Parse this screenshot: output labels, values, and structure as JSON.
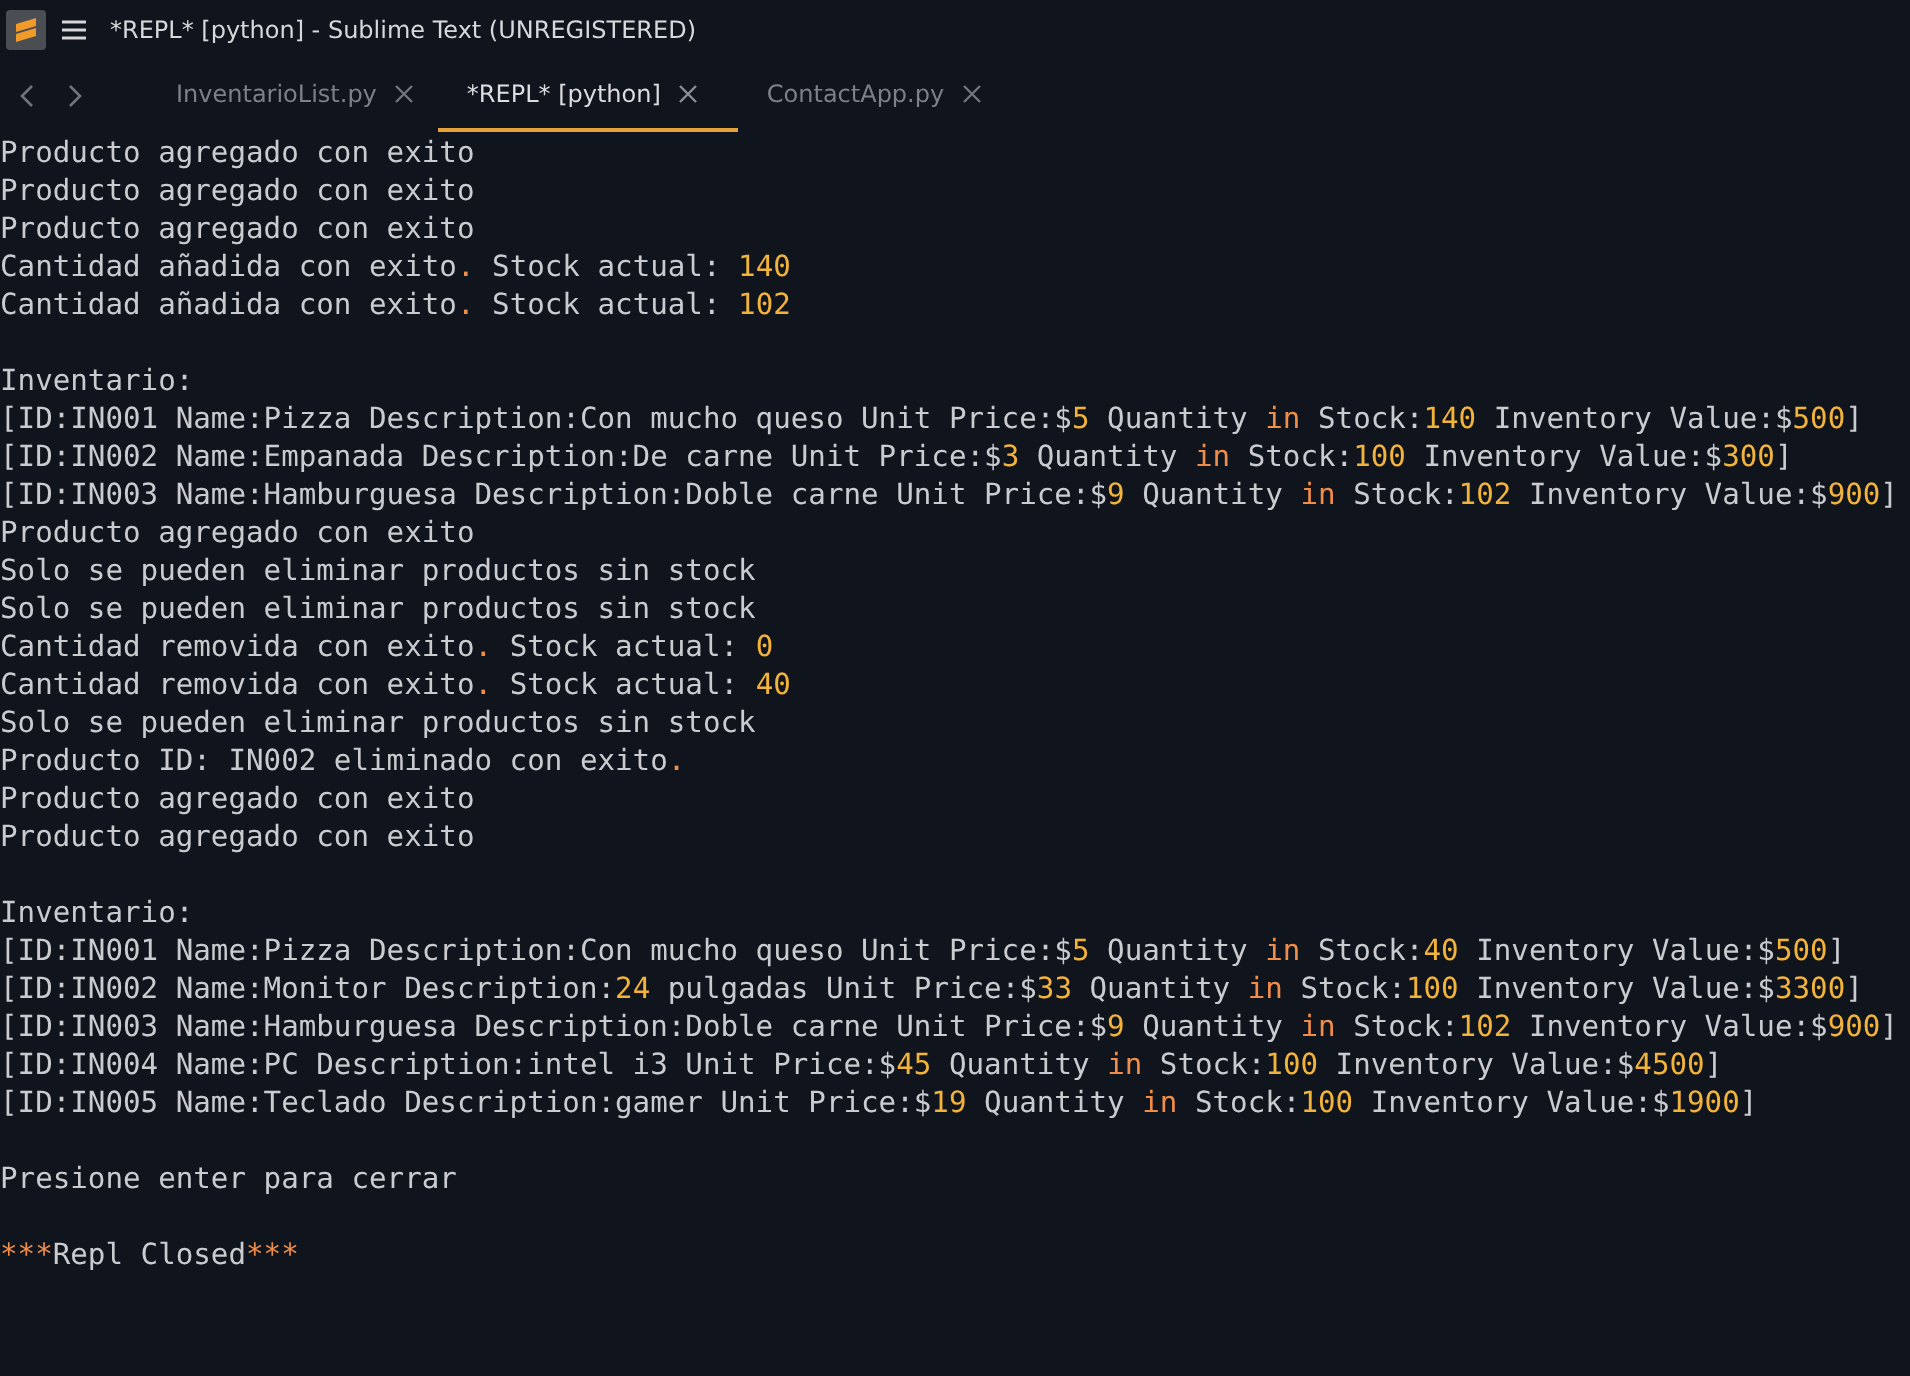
{
  "window": {
    "title": "*REPL* [python] - Sublime Text (UNREGISTERED)"
  },
  "tabs": [
    {
      "label": "InventarioList.py",
      "selected": false
    },
    {
      "label": "*REPL* [python]",
      "selected": true
    },
    {
      "label": "ContactApp.py",
      "selected": false
    }
  ],
  "console": {
    "lines": [
      {
        "kind": "text",
        "segments": [
          {
            "kind": "plain",
            "text": "Producto agregado con exito"
          }
        ]
      },
      {
        "kind": "text",
        "segments": [
          {
            "kind": "plain",
            "text": "Producto agregado con exito"
          }
        ]
      },
      {
        "kind": "text",
        "segments": [
          {
            "kind": "plain",
            "text": "Producto agregado con exito"
          }
        ]
      },
      {
        "kind": "text",
        "segments": [
          {
            "kind": "plain",
            "text": "Cantidad añadida con exito"
          },
          {
            "kind": "operator",
            "text": "."
          },
          {
            "kind": "plain",
            "text": " Stock actual: "
          },
          {
            "kind": "number",
            "text": "140"
          }
        ]
      },
      {
        "kind": "text",
        "segments": [
          {
            "kind": "plain",
            "text": "Cantidad añadida con exito"
          },
          {
            "kind": "operator",
            "text": "."
          },
          {
            "kind": "plain",
            "text": " Stock actual: "
          },
          {
            "kind": "number",
            "text": "102"
          }
        ]
      },
      {
        "kind": "blank"
      },
      {
        "kind": "text",
        "segments": [
          {
            "kind": "plain",
            "text": "Inventario:"
          }
        ]
      },
      {
        "kind": "text",
        "segments": [
          {
            "kind": "plain",
            "text": "[ID:IN001 Name:Pizza Description:Con mucho queso Unit Price:$"
          },
          {
            "kind": "number",
            "text": "5"
          },
          {
            "kind": "plain",
            "text": " Quantity "
          },
          {
            "kind": "keyword",
            "text": "in"
          },
          {
            "kind": "plain",
            "text": " Stock:"
          },
          {
            "kind": "number",
            "text": "140"
          },
          {
            "kind": "plain",
            "text": " Inventory Value:$"
          },
          {
            "kind": "number",
            "text": "500"
          },
          {
            "kind": "plain",
            "text": "]"
          }
        ]
      },
      {
        "kind": "text",
        "segments": [
          {
            "kind": "plain",
            "text": "[ID:IN002 Name:Empanada Description:De carne Unit Price:$"
          },
          {
            "kind": "number",
            "text": "3"
          },
          {
            "kind": "plain",
            "text": " Quantity "
          },
          {
            "kind": "keyword",
            "text": "in"
          },
          {
            "kind": "plain",
            "text": " Stock:"
          },
          {
            "kind": "number",
            "text": "100"
          },
          {
            "kind": "plain",
            "text": " Inventory Value:$"
          },
          {
            "kind": "number",
            "text": "300"
          },
          {
            "kind": "plain",
            "text": "]"
          }
        ]
      },
      {
        "kind": "text",
        "segments": [
          {
            "kind": "plain",
            "text": "[ID:IN003 Name:Hamburguesa Description:Doble carne Unit Price:$"
          },
          {
            "kind": "number",
            "text": "9"
          },
          {
            "kind": "plain",
            "text": " Quantity "
          },
          {
            "kind": "keyword",
            "text": "in"
          },
          {
            "kind": "plain",
            "text": " Stock:"
          },
          {
            "kind": "number",
            "text": "102"
          },
          {
            "kind": "plain",
            "text": " Inventory Value:$"
          },
          {
            "kind": "number",
            "text": "900"
          },
          {
            "kind": "plain",
            "text": "]"
          }
        ]
      },
      {
        "kind": "text",
        "segments": [
          {
            "kind": "plain",
            "text": "Producto agregado con exito"
          }
        ]
      },
      {
        "kind": "text",
        "segments": [
          {
            "kind": "plain",
            "text": "Solo se pueden eliminar productos sin stock"
          }
        ]
      },
      {
        "kind": "text",
        "segments": [
          {
            "kind": "plain",
            "text": "Solo se pueden eliminar productos sin stock"
          }
        ]
      },
      {
        "kind": "text",
        "segments": [
          {
            "kind": "plain",
            "text": "Cantidad removida con exito"
          },
          {
            "kind": "operator",
            "text": "."
          },
          {
            "kind": "plain",
            "text": " Stock actual: "
          },
          {
            "kind": "number",
            "text": "0"
          }
        ]
      },
      {
        "kind": "text",
        "segments": [
          {
            "kind": "plain",
            "text": "Cantidad removida con exito"
          },
          {
            "kind": "operator",
            "text": "."
          },
          {
            "kind": "plain",
            "text": " Stock actual: "
          },
          {
            "kind": "number",
            "text": "40"
          }
        ]
      },
      {
        "kind": "text",
        "segments": [
          {
            "kind": "plain",
            "text": "Solo se pueden eliminar productos sin stock"
          }
        ]
      },
      {
        "kind": "text",
        "segments": [
          {
            "kind": "plain",
            "text": "Producto ID: IN002 eliminado con exito"
          },
          {
            "kind": "operator",
            "text": "."
          }
        ]
      },
      {
        "kind": "text",
        "segments": [
          {
            "kind": "plain",
            "text": "Producto agregado con exito"
          }
        ]
      },
      {
        "kind": "text",
        "segments": [
          {
            "kind": "plain",
            "text": "Producto agregado con exito"
          }
        ]
      },
      {
        "kind": "blank"
      },
      {
        "kind": "text",
        "segments": [
          {
            "kind": "plain",
            "text": "Inventario:"
          }
        ]
      },
      {
        "kind": "text",
        "segments": [
          {
            "kind": "plain",
            "text": "[ID:IN001 Name:Pizza Description:Con mucho queso Unit Price:$"
          },
          {
            "kind": "number",
            "text": "5"
          },
          {
            "kind": "plain",
            "text": " Quantity "
          },
          {
            "kind": "keyword",
            "text": "in"
          },
          {
            "kind": "plain",
            "text": " Stock:"
          },
          {
            "kind": "number",
            "text": "40"
          },
          {
            "kind": "plain",
            "text": " Inventory Value:$"
          },
          {
            "kind": "number",
            "text": "500"
          },
          {
            "kind": "plain",
            "text": "]"
          }
        ]
      },
      {
        "kind": "text",
        "segments": [
          {
            "kind": "plain",
            "text": "[ID:IN002 Name:Monitor Description:"
          },
          {
            "kind": "number",
            "text": "24"
          },
          {
            "kind": "plain",
            "text": " pulgadas Unit Price:$"
          },
          {
            "kind": "number",
            "text": "33"
          },
          {
            "kind": "plain",
            "text": " Quantity "
          },
          {
            "kind": "keyword",
            "text": "in"
          },
          {
            "kind": "plain",
            "text": " Stock:"
          },
          {
            "kind": "number",
            "text": "100"
          },
          {
            "kind": "plain",
            "text": " Inventory Value:$"
          },
          {
            "kind": "number",
            "text": "3300"
          },
          {
            "kind": "plain",
            "text": "]"
          }
        ]
      },
      {
        "kind": "text",
        "segments": [
          {
            "kind": "plain",
            "text": "[ID:IN003 Name:Hamburguesa Description:Doble carne Unit Price:$"
          },
          {
            "kind": "number",
            "text": "9"
          },
          {
            "kind": "plain",
            "text": " Quantity "
          },
          {
            "kind": "keyword",
            "text": "in"
          },
          {
            "kind": "plain",
            "text": " Stock:"
          },
          {
            "kind": "number",
            "text": "102"
          },
          {
            "kind": "plain",
            "text": " Inventory Value:$"
          },
          {
            "kind": "number",
            "text": "900"
          },
          {
            "kind": "plain",
            "text": "]"
          }
        ]
      },
      {
        "kind": "text",
        "segments": [
          {
            "kind": "plain",
            "text": "[ID:IN004 Name:PC Description:intel i3 Unit Price:$"
          },
          {
            "kind": "number",
            "text": "45"
          },
          {
            "kind": "plain",
            "text": " Quantity "
          },
          {
            "kind": "keyword",
            "text": "in"
          },
          {
            "kind": "plain",
            "text": " Stock:"
          },
          {
            "kind": "number",
            "text": "100"
          },
          {
            "kind": "plain",
            "text": " Inventory Value:$"
          },
          {
            "kind": "number",
            "text": "4500"
          },
          {
            "kind": "plain",
            "text": "]"
          }
        ]
      },
      {
        "kind": "text",
        "segments": [
          {
            "kind": "plain",
            "text": "[ID:IN005 Name:Teclado Description:gamer Unit Price:$"
          },
          {
            "kind": "number",
            "text": "19"
          },
          {
            "kind": "plain",
            "text": " Quantity "
          },
          {
            "kind": "keyword",
            "text": "in"
          },
          {
            "kind": "plain",
            "text": " Stock:"
          },
          {
            "kind": "number",
            "text": "100"
          },
          {
            "kind": "plain",
            "text": " Inventory Value:$"
          },
          {
            "kind": "number",
            "text": "1900"
          },
          {
            "kind": "plain",
            "text": "]"
          }
        ]
      },
      {
        "kind": "blank"
      },
      {
        "kind": "text",
        "segments": [
          {
            "kind": "plain",
            "text": "Presione enter para cerrar"
          }
        ]
      },
      {
        "kind": "blank"
      },
      {
        "kind": "text",
        "segments": [
          {
            "kind": "operator",
            "text": "***"
          },
          {
            "kind": "plain",
            "text": "Repl Closed"
          },
          {
            "kind": "operator",
            "text": "***"
          }
        ]
      }
    ]
  }
}
